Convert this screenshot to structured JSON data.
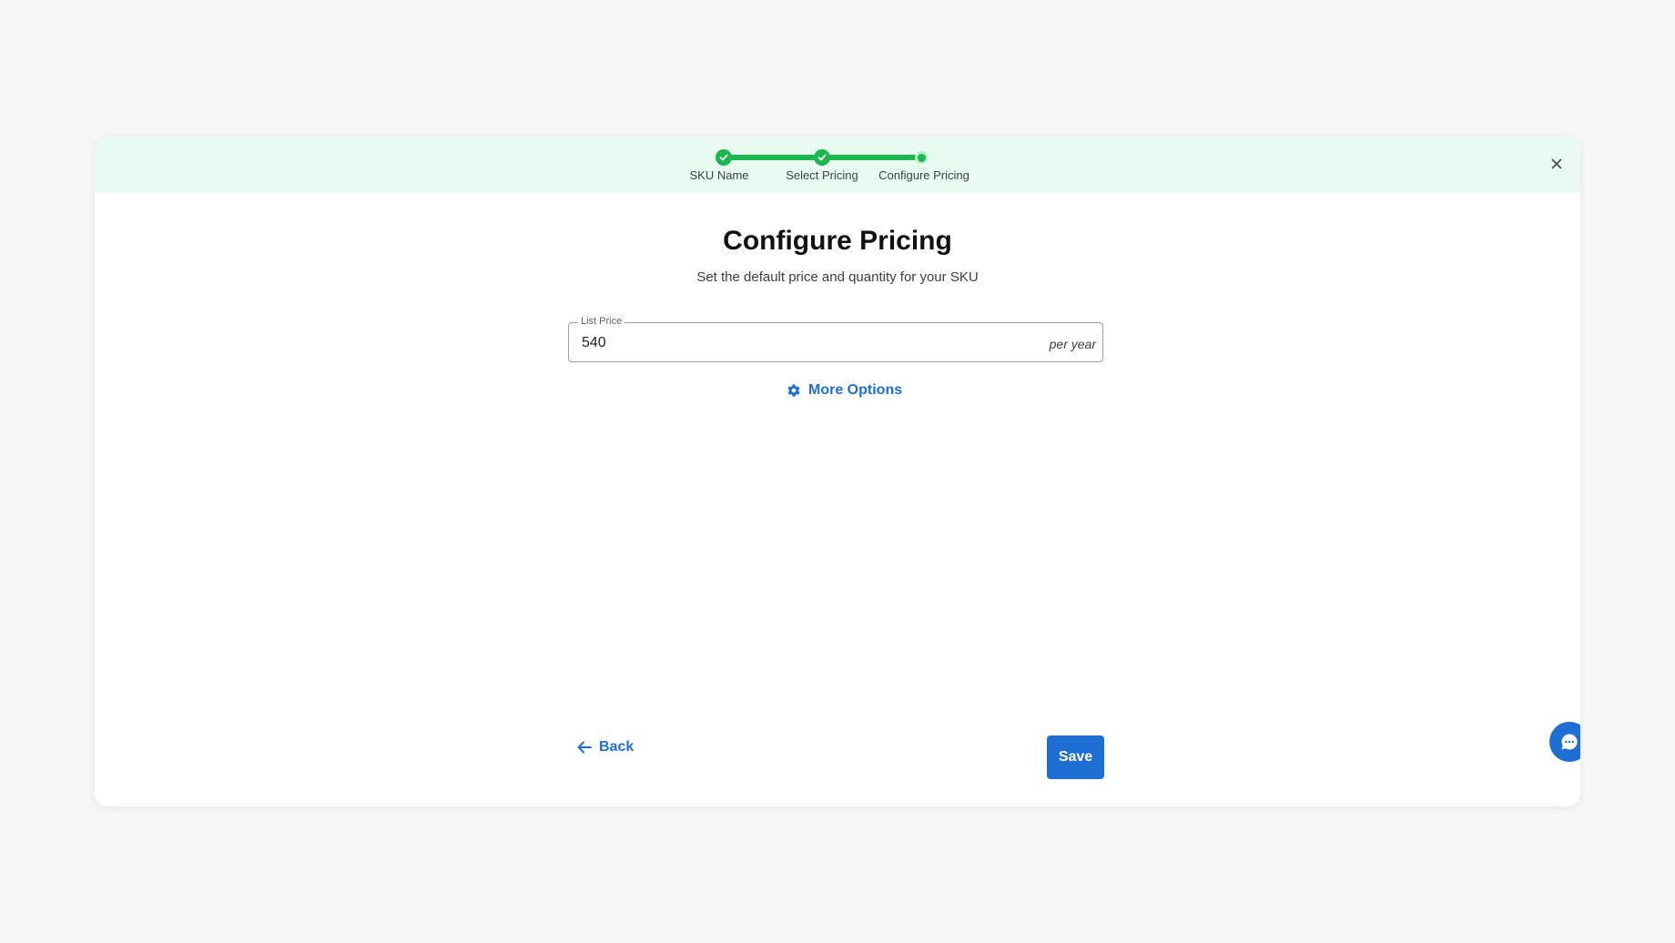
{
  "stepper": {
    "steps": [
      {
        "label": "SKU Name",
        "state": "complete"
      },
      {
        "label": "Select Pricing",
        "state": "complete"
      },
      {
        "label": "Configure Pricing",
        "state": "current"
      }
    ]
  },
  "header": {
    "title": "Configure Pricing",
    "subtitle": "Set the default price and quantity for your SKU"
  },
  "list_price": {
    "label": "List Price",
    "value": "540",
    "suffix": "per year"
  },
  "more_options": {
    "label": "More Options",
    "icon": "gear-icon"
  },
  "footer": {
    "back_label": "Back",
    "save_label": "Save"
  },
  "icons": {
    "close": "close-icon",
    "check": "check-icon",
    "back": "arrow-left-icon",
    "chat": "chat-icon"
  },
  "colors": {
    "accent": "#1e6fd4",
    "success": "#1cb84f",
    "header_bg": "#e9fbf0"
  }
}
